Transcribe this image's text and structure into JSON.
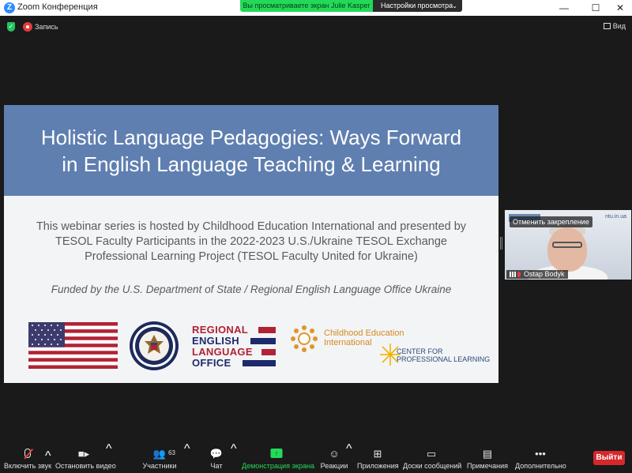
{
  "window": {
    "title": "Zoom Конференция",
    "controls": {
      "minimize": "—",
      "maximize": "☐",
      "close": "✕"
    }
  },
  "share_banner": {
    "text": "Вы просматриваете экран Julie Kasper",
    "view_settings": "Настройки просмотра"
  },
  "status": {
    "recording_label": "Запись",
    "view_label": "Вид"
  },
  "slide": {
    "title_line1": "Holistic Language Pedagogies: Ways Forward",
    "title_line2": "in English Language Teaching & Learning",
    "description": "This webinar series is hosted by Childhood Education International and presented by TESOL Faculty Participants in the 2022-2023 U.S./Ukraine TESOL Exchange Professional Learning Project (TESOL Faculty United for Ukraine)",
    "funded": "Funded by the U.S. Department of State / Regional English Language Office Ukraine",
    "relo": [
      "REGIONAL",
      "ENGLISH",
      "LANGUAGE",
      "OFFICE"
    ],
    "cei": [
      "Childhood Education",
      "International"
    ],
    "cpl": [
      "CENTER FOR",
      "PROFESSIONAL LEARNING"
    ],
    "colors": {
      "header": "#5f7fb0",
      "body": "#f3f4f6",
      "relo_red": "#b22234",
      "cei_orange": "#d48a1f"
    }
  },
  "participant_tile": {
    "overlay": "Отменить закрепление",
    "name": "Ostap Bodyk",
    "logo_right": "ntu.in.ua"
  },
  "toolbar": {
    "mute": "Включить звук",
    "video": "Остановить видео",
    "participants": "Участники",
    "participants_count": "63",
    "chat": "Чат",
    "share": "Демонстрация экрана",
    "reactions": "Реакции",
    "apps": "Приложения",
    "whiteboards": "Доски сообщений",
    "notes": "Примечания",
    "more": "Дополнительно",
    "leave": "Выйти"
  }
}
